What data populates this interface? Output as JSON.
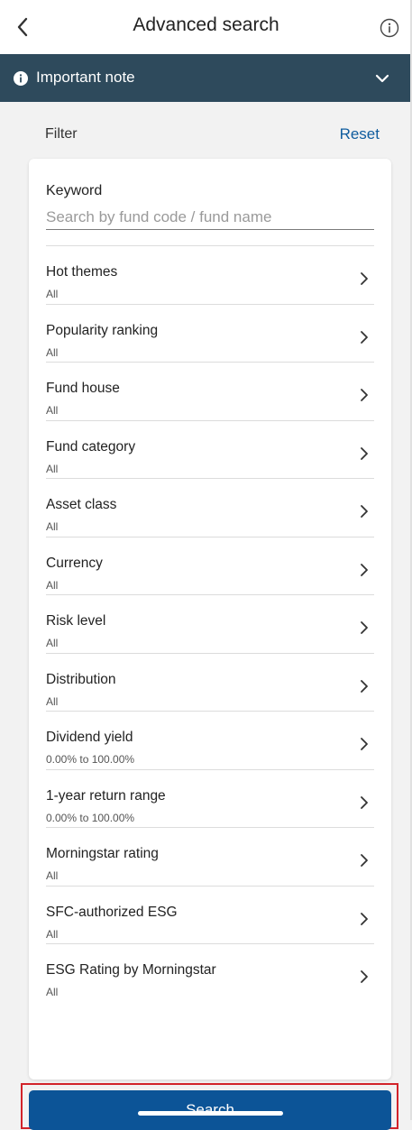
{
  "header": {
    "title": "Advanced search",
    "back_icon": "chevron-left-icon",
    "info_icon": "info-circle-icon"
  },
  "note_bar": {
    "label": "Important note",
    "icon": "info-filled-icon",
    "chevron": "chevron-down-icon",
    "color": "#2e4a5c"
  },
  "filter": {
    "label": "Filter",
    "reset_label": "Reset"
  },
  "keyword": {
    "label": "Keyword",
    "placeholder": "Search by fund code / fund name",
    "value": ""
  },
  "filters": [
    {
      "title": "Hot themes",
      "value": "All"
    },
    {
      "title": "Popularity ranking",
      "value": "All"
    },
    {
      "title": "Fund house",
      "value": "All"
    },
    {
      "title": "Fund category",
      "value": "All"
    },
    {
      "title": "Asset class",
      "value": "All"
    },
    {
      "title": "Currency",
      "value": "All"
    },
    {
      "title": "Risk level",
      "value": "All"
    },
    {
      "title": "Distribution",
      "value": "All"
    },
    {
      "title": "Dividend yield",
      "value": "0.00% to 100.00%"
    },
    {
      "title": "1-year return range",
      "value": "0.00% to 100.00%"
    },
    {
      "title": "Morningstar rating",
      "value": "All"
    },
    {
      "title": "SFC-authorized ESG",
      "value": "All"
    },
    {
      "title": "ESG Rating by Morningstar",
      "value": "All"
    }
  ],
  "search_button": {
    "label": "Search",
    "color": "#0c5497",
    "highlight_color": "#d2232a"
  }
}
